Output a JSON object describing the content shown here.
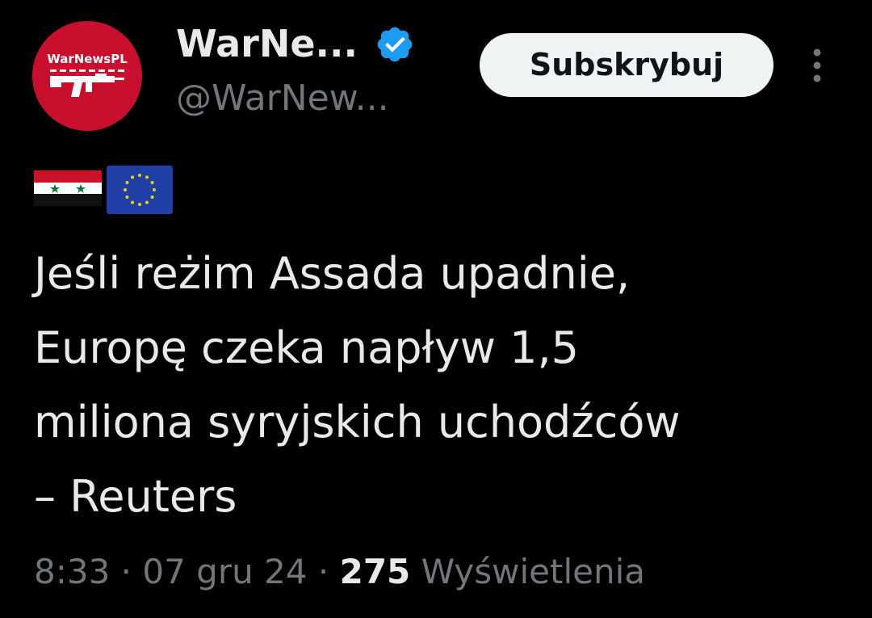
{
  "author": {
    "avatar_text": "WarNewsPL",
    "display_name": "WarNe...",
    "handle": "@WarNew...",
    "verified_icon": "verified-badge-icon",
    "avatar_color": "#c8102e"
  },
  "actions": {
    "subscribe_label": "Subskrybuj",
    "more_icon": "more-vertical-icon"
  },
  "tweet": {
    "flags": [
      "flag-syria",
      "flag-eu"
    ],
    "lines": [
      "Jeśli reżim Assada upadnie,",
      "Europę czeka napływ 1,5",
      "miliona syryjskich uchodźców",
      "– Reuters"
    ]
  },
  "meta": {
    "time": "8:33",
    "separator": " · ",
    "date": "07 gru 24",
    "views_count": "275",
    "views_label": "Wyświetlenia"
  },
  "colors": {
    "background": "#000000",
    "text_primary": "#e7e9ea",
    "text_secondary": "#71767b",
    "verified_blue": "#1d9bf0",
    "button_bg": "#eff3f4"
  }
}
